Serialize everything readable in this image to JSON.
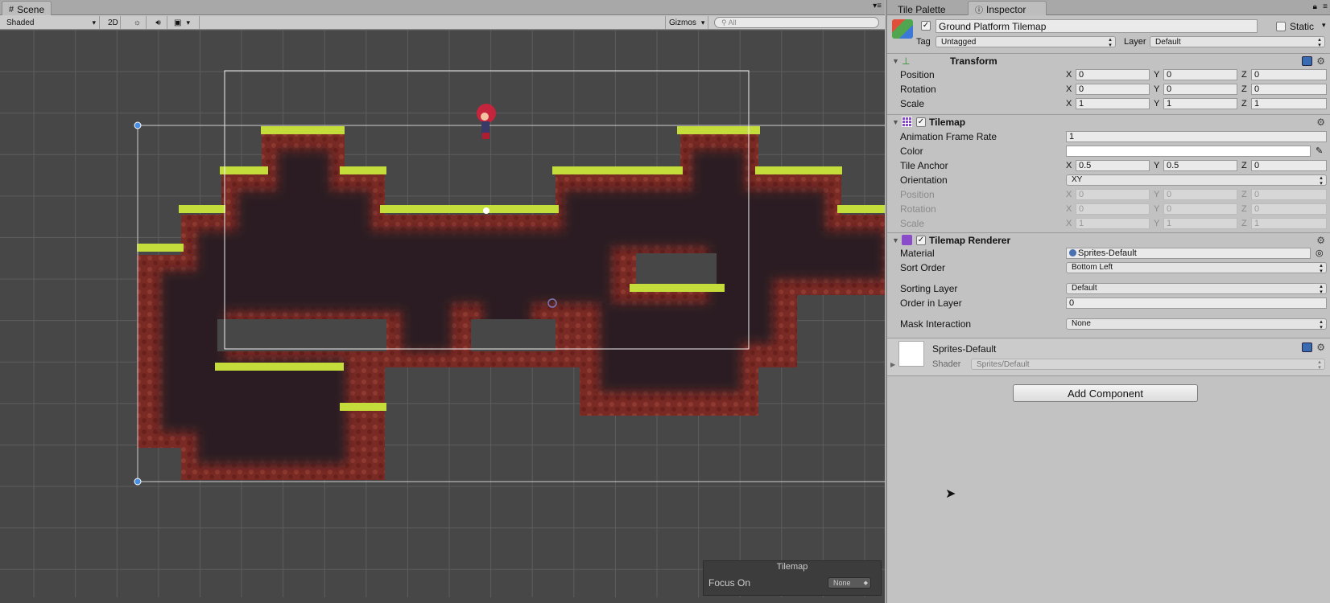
{
  "scene": {
    "tab_label": "Scene",
    "shading_mode": "Shaded",
    "mode_2d": "2D",
    "gizmos_label": "Gizmos",
    "search_placeholder": "All",
    "overlay": {
      "title": "Tilemap",
      "focus_label": "Focus On",
      "focus_value": "None"
    }
  },
  "inspector": {
    "tabs": [
      {
        "label": "Tile Palette"
      },
      {
        "label": "Inspector"
      }
    ],
    "object": {
      "name": "Ground Platform Tilemap",
      "static_label": "Static",
      "tag_label": "Tag",
      "tag_value": "Untagged",
      "layer_label": "Layer",
      "layer_value": "Default"
    },
    "transform": {
      "title": "Transform",
      "position_label": "Position",
      "position": {
        "x": "0",
        "y": "0",
        "z": "0"
      },
      "rotation_label": "Rotation",
      "rotation": {
        "x": "0",
        "y": "0",
        "z": "0"
      },
      "scale_label": "Scale",
      "scale": {
        "x": "1",
        "y": "1",
        "z": "1"
      }
    },
    "tilemap": {
      "title": "Tilemap",
      "anim_rate_label": "Animation Frame Rate",
      "anim_rate": "1",
      "color_label": "Color",
      "tile_anchor_label": "Tile Anchor",
      "tile_anchor": {
        "x": "0.5",
        "y": "0.5",
        "z": "0"
      },
      "orientation_label": "Orientation",
      "orientation": "XY",
      "position_label": "Position",
      "position": {
        "x": "0",
        "y": "0",
        "z": "0"
      },
      "rotation_label": "Rotation",
      "rotation": {
        "x": "0",
        "y": "0",
        "z": "0"
      },
      "scale_label": "Scale",
      "scale": {
        "x": "1",
        "y": "1",
        "z": "1"
      }
    },
    "renderer": {
      "title": "Tilemap Renderer",
      "material_label": "Material",
      "material": "Sprites-Default",
      "sort_order_label": "Sort Order",
      "sort_order": "Bottom Left",
      "sorting_layer_label": "Sorting Layer",
      "sorting_layer": "Default",
      "order_label": "Order in Layer",
      "order": "0",
      "mask_label": "Mask Interaction",
      "mask": "None"
    },
    "material": {
      "name": "Sprites-Default",
      "shader_label": "Shader",
      "shader": "Sprites/Default"
    },
    "add_component": "Add Component",
    "axes": {
      "x": "X",
      "y": "Y",
      "z": "Z"
    }
  },
  "colors": {
    "grass": "#c5dd3a",
    "rock": "#7a2a24",
    "cave": "#2a1e22",
    "viewport": "#474747"
  }
}
